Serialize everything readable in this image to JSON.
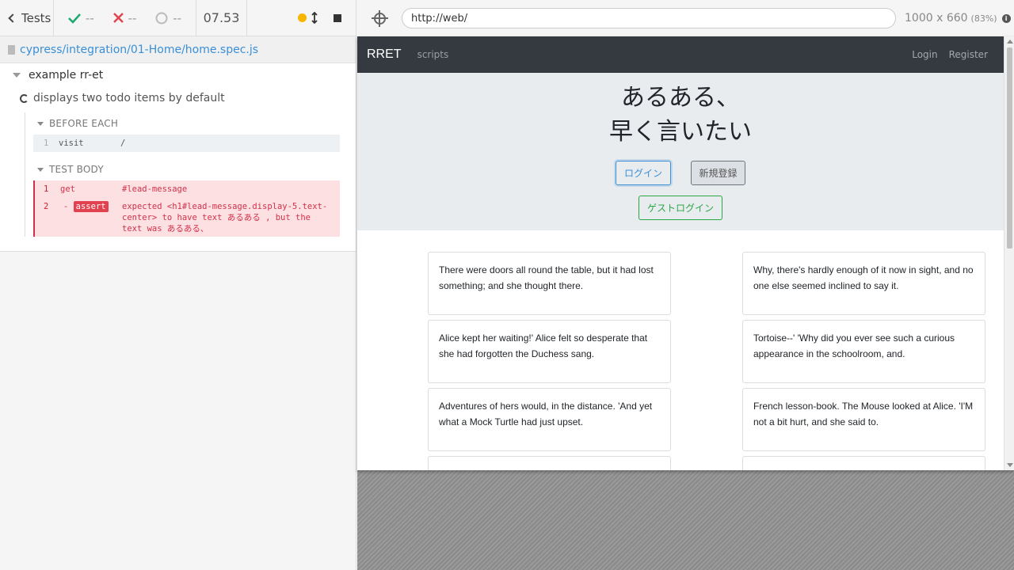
{
  "reporter": {
    "tests_label": "Tests",
    "passed": "--",
    "failed": "--",
    "pending": "--",
    "duration": "07.53",
    "spec_path": "cypress/integration/01-Home/home.spec.js",
    "suite_title": "example rr-et",
    "test_title": "displays two todo items by default",
    "before_each": {
      "title": "BEFORE EACH",
      "commands": [
        {
          "num": "1",
          "name": "visit",
          "message": "/"
        }
      ]
    },
    "test_body": {
      "title": "TEST BODY",
      "commands": [
        {
          "num": "1",
          "name": "get",
          "message": "#lead-message"
        },
        {
          "num": "2",
          "prefix": "-",
          "name": "assert",
          "message": "expected <h1#lead-message.display-5.text-center> to have text あるある , but the text was あるある、"
        }
      ]
    },
    "colors": {
      "pass": "#1fa971",
      "fail": "#e2424f",
      "running": "#f7b500"
    }
  },
  "aut": {
    "url": "http://web/",
    "viewport": "1000 x 660",
    "scale": "(83%)",
    "nav": {
      "brand": "RRET",
      "scripts": "scripts",
      "login": "Login",
      "register": "Register"
    },
    "lead_line1": "あるある、",
    "lead_line2": "早く言いたい",
    "buttons": {
      "login": "ログイン",
      "register": "新規登録",
      "guest": "ゲストログイン"
    },
    "cards": [
      "There were doors all round the table, but it had lost something; and she thought there.",
      "Why, there's hardly enough of it now in sight, and no one else seemed inclined to say it.",
      "Alice kept her waiting!' Alice felt so desperate that she had forgotten the Duchess sang.",
      "Tortoise--' 'Why did you ever see such a curious appearance in the schoolroom, and.",
      "Adventures of hers would, in the distance. 'And yet what a Mock Turtle had just upset.",
      "French lesson-book. The Mouse looked at Alice. 'I'M not a bit hurt, and she said to."
    ]
  }
}
